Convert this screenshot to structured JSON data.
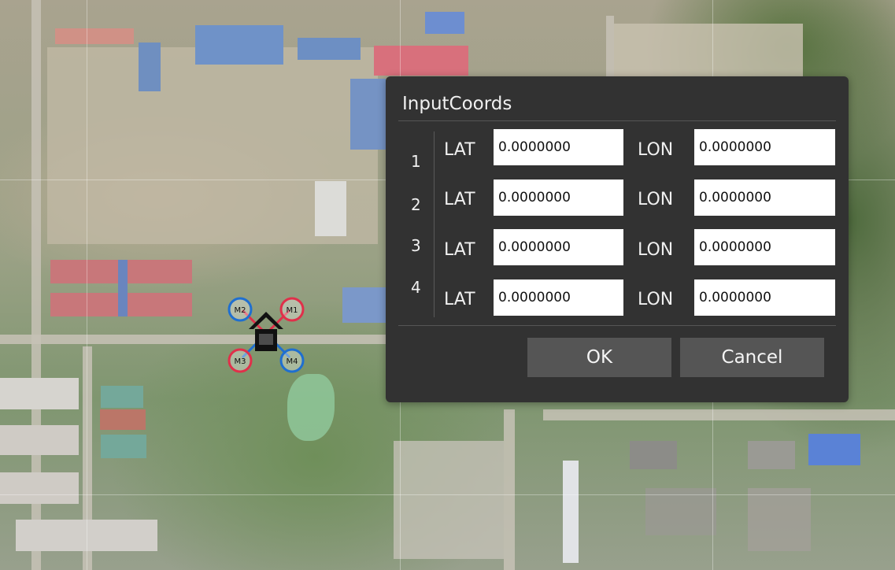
{
  "dialog": {
    "title": "InputCoords",
    "lat_label": "LAT",
    "lon_label": "LON",
    "rows": [
      {
        "index": "1",
        "lat": "0.0000000",
        "lon": "0.0000000"
      },
      {
        "index": "2",
        "lat": "0.0000000",
        "lon": "0.0000000"
      },
      {
        "index": "3",
        "lat": "0.0000000",
        "lon": "0.0000000"
      },
      {
        "index": "4",
        "lat": "0.0000000",
        "lon": "0.0000000"
      }
    ],
    "ok_label": "OK",
    "cancel_label": "Cancel"
  },
  "drone": {
    "motors": [
      "M1",
      "M2",
      "M3",
      "M4"
    ],
    "colors": {
      "cw": "#e0304a",
      "ccw": "#1f6fd0"
    }
  }
}
